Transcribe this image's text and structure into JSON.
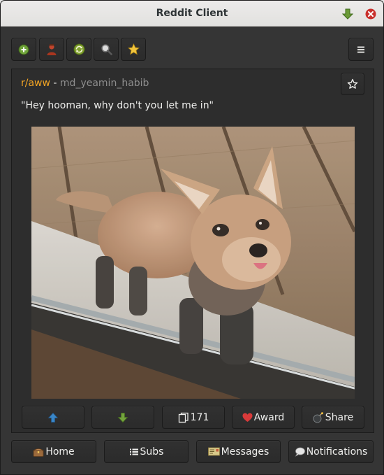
{
  "window": {
    "title": "Reddit Client"
  },
  "toolbar": {
    "buttons": [
      {
        "icon": "add-icon"
      },
      {
        "icon": "user-icon"
      },
      {
        "icon": "refresh-icon"
      },
      {
        "icon": "search-icon"
      },
      {
        "icon": "favorites-icon"
      }
    ],
    "menu_icon": "hamburger-menu-icon"
  },
  "post": {
    "subreddit": "r/aww",
    "separator": "-",
    "author": "md_yeamin_habib",
    "title": "\"Hey hooman, why don't you let me in\"",
    "image_alt": "fox kit at glass door",
    "actions": {
      "comments": "171",
      "award": "Award",
      "share": "Share"
    }
  },
  "nav": {
    "home": "Home",
    "subs": "Subs",
    "messages": "Messages",
    "notifications": "Notifications"
  },
  "colors": {
    "subreddit": "#f5a623",
    "upvote": "#3a87c8",
    "downvote": "#73a33d",
    "close": "#c9302c",
    "award": "#d93a3a"
  }
}
